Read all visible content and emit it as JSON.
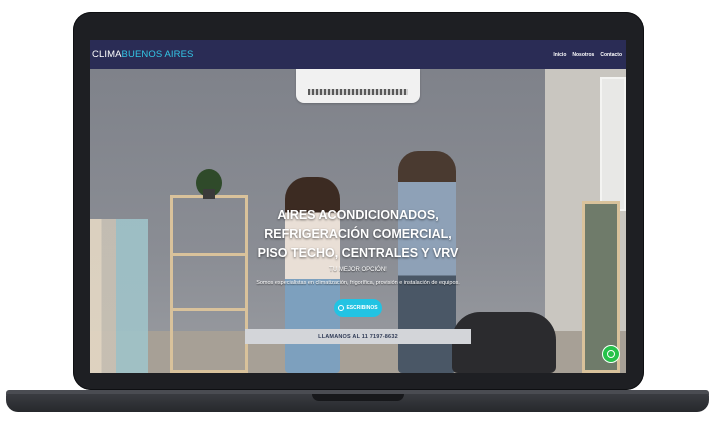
{
  "brand": {
    "prefix": "CLIMA",
    "accent": "BUENOS AIRES",
    "accent_color": "#33c6e6"
  },
  "nav": {
    "items": [
      {
        "label": "Inicio"
      },
      {
        "label": "Nosotros"
      },
      {
        "label": "Contacto"
      }
    ]
  },
  "hero": {
    "title_line1": "AIRES ACONDICIONADOS,",
    "title_line2": "REFRIGERACIÓN COMERCIAL,",
    "title_line3": "PISO TECHO, CENTRALES Y VRV",
    "subtitle": "TU MEJOR OPCIÓN!",
    "description": "Somos especialistas en climatización, frigorífica, provisión e instalación de equipos.",
    "cta_label": "ESCRIBINOS",
    "cta_icon": "whatsapp-icon",
    "call_label": "LLAMANOS AL 11 7197-8632"
  },
  "colors": {
    "nav_bg": "#2a2c55",
    "cta": "#22c3e3",
    "whatsapp": "#26c24a"
  },
  "floating": {
    "icon": "whatsapp-icon"
  }
}
